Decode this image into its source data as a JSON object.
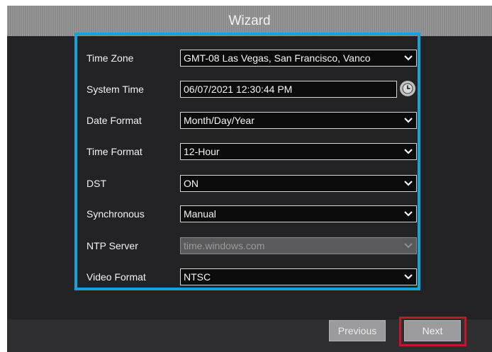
{
  "window": {
    "title": "Wizard"
  },
  "form": {
    "time_zone": {
      "label": "Time Zone",
      "value": "GMT-08 Las Vegas, San Francisco, Vanco"
    },
    "system_time": {
      "label": "System Time",
      "value": "06/07/2021 12:30:44 PM"
    },
    "date_format": {
      "label": "Date Format",
      "value": "Month/Day/Year"
    },
    "time_format": {
      "label": "Time Format",
      "value": "12-Hour"
    },
    "dst": {
      "label": "DST",
      "value": "ON"
    },
    "synchronous": {
      "label": "Synchronous",
      "value": "Manual"
    },
    "ntp_server": {
      "label": "NTP Server",
      "value": "time.windows.com",
      "disabled": true
    },
    "video_format": {
      "label": "Video Format",
      "value": "NTSC"
    }
  },
  "footer": {
    "previous_label": "Previous",
    "next_label": "Next"
  },
  "colors": {
    "highlight_box": "#16a3da",
    "next_highlight": "#c4182a",
    "background": "#232325"
  },
  "icons": {
    "dropdown": "chevron-down-icon",
    "time_picker": "clock-icon"
  }
}
